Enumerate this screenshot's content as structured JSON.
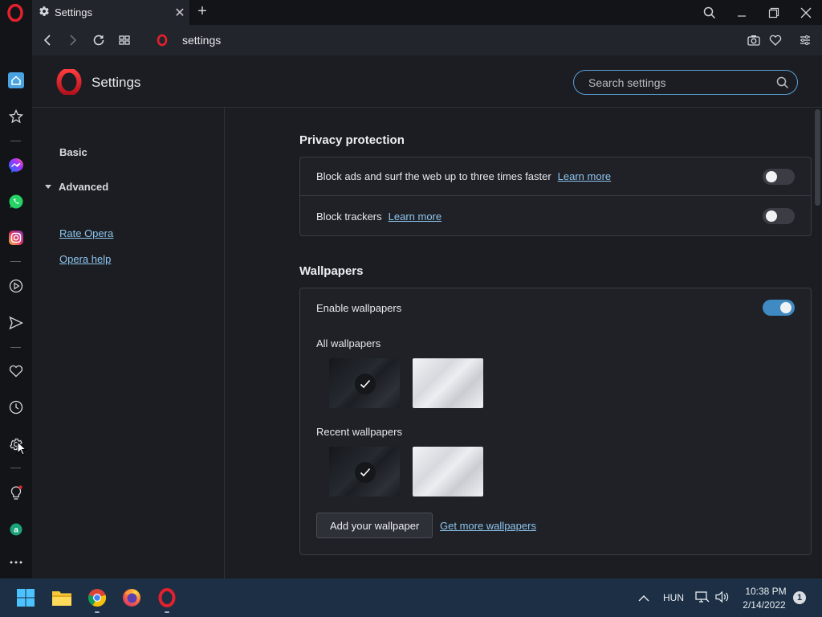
{
  "tab": {
    "title": "Settings",
    "new_tab": "+"
  },
  "address": {
    "url": "settings"
  },
  "header": {
    "title": "Settings",
    "search_placeholder": "Search settings"
  },
  "leftnav": {
    "basic": "Basic",
    "advanced": "Advanced",
    "rate_opera": "Rate Opera",
    "opera_help": "Opera help"
  },
  "privacy": {
    "title": "Privacy protection",
    "block_ads": "Block ads and surf the web up to three times faster",
    "block_ads_link": "Learn more",
    "block_ads_enabled": false,
    "block_trackers": "Block trackers",
    "block_trackers_link": "Learn more",
    "block_trackers_enabled": false
  },
  "wallpapers": {
    "title": "Wallpapers",
    "enable": "Enable wallpapers",
    "enabled": true,
    "all_title": "All wallpapers",
    "recent_title": "Recent wallpapers",
    "add_button": "Add your wallpaper",
    "get_more_link": "Get more wallpapers"
  },
  "taskbar": {
    "language": "HUN",
    "time": "10:38 PM",
    "date": "2/14/2022",
    "notifications": "1"
  },
  "colors": {
    "accent": "#3f8ac2",
    "link": "#8ec5ee",
    "opera_red": "#e3212e"
  }
}
